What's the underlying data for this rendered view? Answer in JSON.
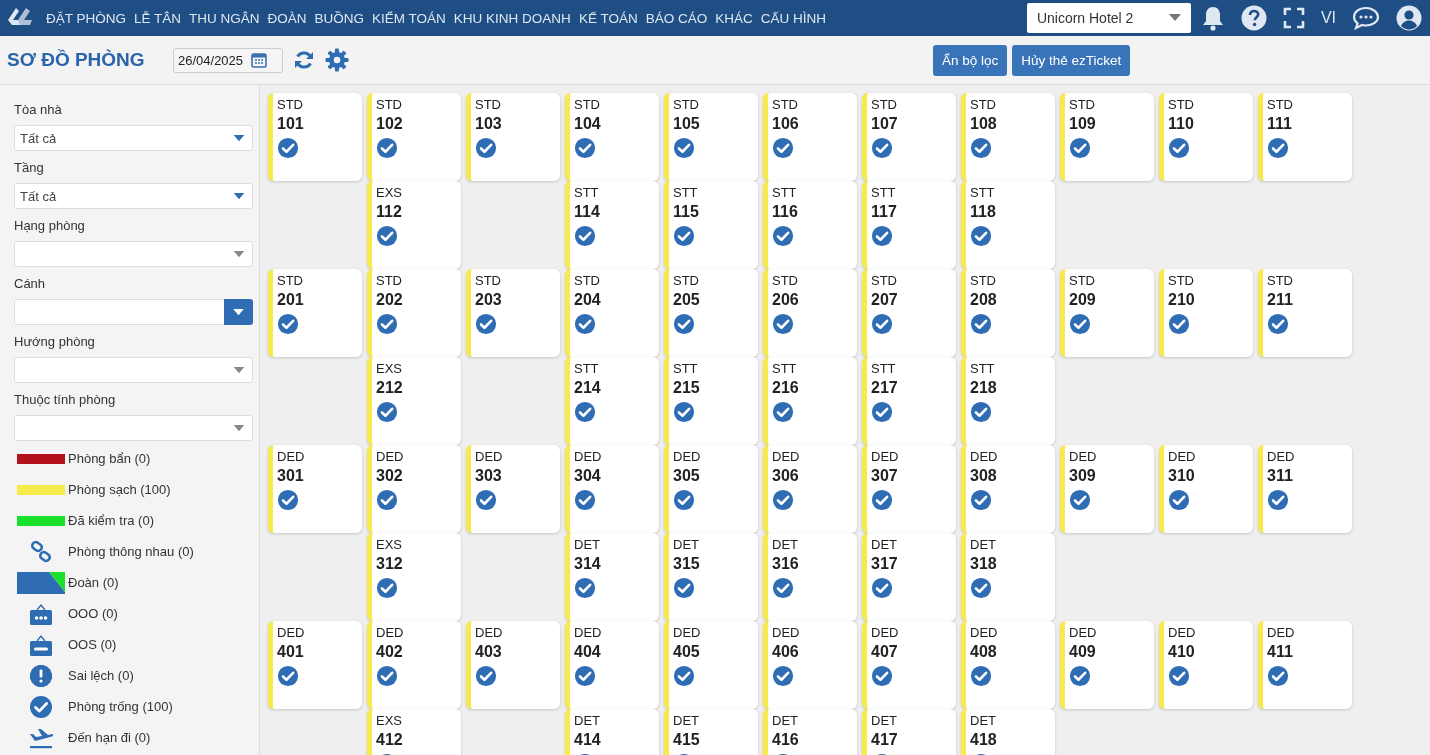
{
  "nav": {
    "menu": [
      "ĐẶT PHÒNG",
      "LỄ TÂN",
      "THU NGÂN",
      "ĐOÀN",
      "BUỒNG",
      "KIỂM TOÁN",
      "KHU KINH DOANH",
      "KẾ TOÁN",
      "BÁO CÁO",
      "KHÁC",
      "CẤU HÌNH"
    ],
    "hotel_select": "Unicorn Hotel 2",
    "language": "VI"
  },
  "toolbar": {
    "title": "SƠ ĐỒ PHÒNG",
    "date": "26/04/2025",
    "buttons": [
      "Ẩn bộ lọc",
      "Hủy thẻ ezTicket"
    ]
  },
  "filters": [
    {
      "label": "Tòa nhà",
      "value": "Tất cả",
      "kind": "plain"
    },
    {
      "label": "Tầng",
      "value": "Tất cả",
      "kind": "plain"
    },
    {
      "label": "Hạng phòng",
      "kind": "plain"
    },
    {
      "label": "Cánh",
      "kind": "button"
    },
    {
      "label": "Hướng phòng",
      "kind": "plain"
    },
    {
      "label": "Thuộc tính phòng",
      "kind": "plain"
    }
  ],
  "legend": [
    {
      "kind": "bar",
      "color": "#b3121c",
      "label": "Phòng bẩn (0)"
    },
    {
      "kind": "bar",
      "color": "#f6eb4a",
      "label": "Phòng sạch (100)"
    },
    {
      "kind": "bar",
      "color": "#19e02a",
      "label": "Đã kiểm tra (0)"
    },
    {
      "kind": "link",
      "label": "Phòng thông nhau (0)"
    },
    {
      "kind": "group",
      "label": "Đoàn (0)"
    },
    {
      "kind": "ooo",
      "label": "OOO (0)"
    },
    {
      "kind": "oos",
      "label": "OOS (0)"
    },
    {
      "kind": "alert",
      "label": "Sai lệch (0)"
    },
    {
      "kind": "vacant",
      "label": "Phòng trống (100)"
    },
    {
      "kind": "departure",
      "label": "Đến hạn đi (0)"
    }
  ],
  "room_rows": [
    {
      "cells": [
        {
          "kind": "room",
          "type": "STD",
          "number": "101",
          "color": "#f6eb4a",
          "vacant": true
        },
        {
          "kind": "room",
          "type": "STD",
          "number": "102",
          "color": "#f6eb4a",
          "vacant": true
        },
        {
          "kind": "room",
          "type": "STD",
          "number": "103",
          "color": "#f6eb4a",
          "vacant": true
        },
        {
          "kind": "room",
          "type": "STD",
          "number": "104",
          "color": "#f6eb4a",
          "vacant": true
        },
        {
          "kind": "room",
          "type": "STD",
          "number": "105",
          "color": "#f6eb4a",
          "vacant": true
        },
        {
          "kind": "room",
          "type": "STD",
          "number": "106",
          "color": "#f6eb4a",
          "vacant": true
        },
        {
          "kind": "room",
          "type": "STD",
          "number": "107",
          "color": "#f6eb4a",
          "vacant": true
        },
        {
          "kind": "room",
          "type": "STD",
          "number": "108",
          "color": "#f6eb4a",
          "vacant": true
        },
        {
          "kind": "room",
          "type": "STD",
          "number": "109",
          "color": "#f6eb4a",
          "vacant": true
        },
        {
          "kind": "room",
          "type": "STD",
          "number": "110",
          "color": "#f6eb4a",
          "vacant": true
        },
        {
          "kind": "room",
          "type": "STD",
          "number": "111",
          "color": "#f6eb4a",
          "vacant": true
        }
      ]
    },
    {
      "cells": [
        {
          "kind": "empty"
        },
        {
          "kind": "room",
          "type": "EXS",
          "number": "112",
          "color": "#f6eb4a",
          "vacant": true
        },
        {
          "kind": "empty"
        },
        {
          "kind": "room",
          "type": "STT",
          "number": "114",
          "color": "#f6eb4a",
          "vacant": true
        },
        {
          "kind": "room",
          "type": "STT",
          "number": "115",
          "color": "#f6eb4a",
          "vacant": true
        },
        {
          "kind": "room",
          "type": "STT",
          "number": "116",
          "color": "#f6eb4a",
          "vacant": true
        },
        {
          "kind": "room",
          "type": "STT",
          "number": "117",
          "color": "#f6eb4a",
          "vacant": true
        },
        {
          "kind": "room",
          "type": "STT",
          "number": "118",
          "color": "#f6eb4a",
          "vacant": true
        }
      ]
    },
    {
      "cells": [
        {
          "kind": "room",
          "type": "STD",
          "number": "201",
          "color": "#f6eb4a",
          "vacant": true
        },
        {
          "kind": "room",
          "type": "STD",
          "number": "202",
          "color": "#f6eb4a",
          "vacant": true
        },
        {
          "kind": "room",
          "type": "STD",
          "number": "203",
          "color": "#f6eb4a",
          "vacant": true
        },
        {
          "kind": "room",
          "type": "STD",
          "number": "204",
          "color": "#f6eb4a",
          "vacant": true
        },
        {
          "kind": "room",
          "type": "STD",
          "number": "205",
          "color": "#f6eb4a",
          "vacant": true
        },
        {
          "kind": "room",
          "type": "STD",
          "number": "206",
          "color": "#f6eb4a",
          "vacant": true
        },
        {
          "kind": "room",
          "type": "STD",
          "number": "207",
          "color": "#f6eb4a",
          "vacant": true
        },
        {
          "kind": "room",
          "type": "STD",
          "number": "208",
          "color": "#f6eb4a",
          "vacant": true
        },
        {
          "kind": "room",
          "type": "STD",
          "number": "209",
          "color": "#f6eb4a",
          "vacant": true
        },
        {
          "kind": "room",
          "type": "STD",
          "number": "210",
          "color": "#f6eb4a",
          "vacant": true
        },
        {
          "kind": "room",
          "type": "STD",
          "number": "211",
          "color": "#f6eb4a",
          "vacant": true
        }
      ]
    },
    {
      "cells": [
        {
          "kind": "empty"
        },
        {
          "kind": "room",
          "type": "EXS",
          "number": "212",
          "color": "#f6eb4a",
          "vacant": true
        },
        {
          "kind": "empty"
        },
        {
          "kind": "room",
          "type": "STT",
          "number": "214",
          "color": "#f6eb4a",
          "vacant": true
        },
        {
          "kind": "room",
          "type": "STT",
          "number": "215",
          "color": "#f6eb4a",
          "vacant": true
        },
        {
          "kind": "room",
          "type": "STT",
          "number": "216",
          "color": "#f6eb4a",
          "vacant": true
        },
        {
          "kind": "room",
          "type": "STT",
          "number": "217",
          "color": "#f6eb4a",
          "vacant": true
        },
        {
          "kind": "room",
          "type": "STT",
          "number": "218",
          "color": "#f6eb4a",
          "vacant": true
        }
      ]
    },
    {
      "cells": [
        {
          "kind": "room",
          "type": "DED",
          "number": "301",
          "color": "#f6eb4a",
          "vacant": true
        },
        {
          "kind": "room",
          "type": "DED",
          "number": "302",
          "color": "#f6eb4a",
          "vacant": true
        },
        {
          "kind": "room",
          "type": "DED",
          "number": "303",
          "color": "#f6eb4a",
          "vacant": true
        },
        {
          "kind": "room",
          "type": "DED",
          "number": "304",
          "color": "#f6eb4a",
          "vacant": true
        },
        {
          "kind": "room",
          "type": "DED",
          "number": "305",
          "color": "#f6eb4a",
          "vacant": true
        },
        {
          "kind": "room",
          "type": "DED",
          "number": "306",
          "color": "#f6eb4a",
          "vacant": true
        },
        {
          "kind": "room",
          "type": "DED",
          "number": "307",
          "color": "#f6eb4a",
          "vacant": true
        },
        {
          "kind": "room",
          "type": "DED",
          "number": "308",
          "color": "#f6eb4a",
          "vacant": true
        },
        {
          "kind": "room",
          "type": "DED",
          "number": "309",
          "color": "#f6eb4a",
          "vacant": true
        },
        {
          "kind": "room",
          "type": "DED",
          "number": "310",
          "color": "#f6eb4a",
          "vacant": true
        },
        {
          "kind": "room",
          "type": "DED",
          "number": "311",
          "color": "#f6eb4a",
          "vacant": true
        }
      ]
    },
    {
      "cells": [
        {
          "kind": "empty"
        },
        {
          "kind": "room",
          "type": "EXS",
          "number": "312",
          "color": "#f6eb4a",
          "vacant": true
        },
        {
          "kind": "empty"
        },
        {
          "kind": "room",
          "type": "DET",
          "number": "314",
          "color": "#f6eb4a",
          "vacant": true
        },
        {
          "kind": "room",
          "type": "DET",
          "number": "315",
          "color": "#f6eb4a",
          "vacant": true
        },
        {
          "kind": "room",
          "type": "DET",
          "number": "316",
          "color": "#f6eb4a",
          "vacant": true
        },
        {
          "kind": "room",
          "type": "DET",
          "number": "317",
          "color": "#f6eb4a",
          "vacant": true
        },
        {
          "kind": "room",
          "type": "DET",
          "number": "318",
          "color": "#f6eb4a",
          "vacant": true
        }
      ]
    },
    {
      "cells": [
        {
          "kind": "room",
          "type": "DED",
          "number": "401",
          "color": "#f6eb4a",
          "vacant": true
        },
        {
          "kind": "room",
          "type": "DED",
          "number": "402",
          "color": "#f6eb4a",
          "vacant": true
        },
        {
          "kind": "room",
          "type": "DED",
          "number": "403",
          "color": "#f6eb4a",
          "vacant": true
        },
        {
          "kind": "room",
          "type": "DED",
          "number": "404",
          "color": "#f6eb4a",
          "vacant": true
        },
        {
          "kind": "room",
          "type": "DED",
          "number": "405",
          "color": "#f6eb4a",
          "vacant": true
        },
        {
          "kind": "room",
          "type": "DED",
          "number": "406",
          "color": "#f6eb4a",
          "vacant": true
        },
        {
          "kind": "room",
          "type": "DED",
          "number": "407",
          "color": "#f6eb4a",
          "vacant": true
        },
        {
          "kind": "room",
          "type": "DED",
          "number": "408",
          "color": "#f6eb4a",
          "vacant": true
        },
        {
          "kind": "room",
          "type": "DED",
          "number": "409",
          "color": "#f6eb4a",
          "vacant": true
        },
        {
          "kind": "room",
          "type": "DED",
          "number": "410",
          "color": "#f6eb4a",
          "vacant": true
        },
        {
          "kind": "room",
          "type": "DED",
          "number": "411",
          "color": "#f6eb4a",
          "vacant": true
        }
      ]
    },
    {
      "cells": [
        {
          "kind": "empty"
        },
        {
          "kind": "room",
          "type": "EXS",
          "number": "412",
          "color": "#f6eb4a",
          "vacant": true
        },
        {
          "kind": "empty"
        },
        {
          "kind": "room",
          "type": "DET",
          "number": "414",
          "color": "#f6eb4a",
          "vacant": true
        },
        {
          "kind": "room",
          "type": "DET",
          "number": "415",
          "color": "#f6eb4a",
          "vacant": true
        },
        {
          "kind": "room",
          "type": "DET",
          "number": "416",
          "color": "#f6eb4a",
          "vacant": true
        },
        {
          "kind": "room",
          "type": "DET",
          "number": "417",
          "color": "#f6eb4a",
          "vacant": true
        },
        {
          "kind": "room",
          "type": "DET",
          "number": "418",
          "color": "#f6eb4a",
          "vacant": true
        }
      ]
    }
  ]
}
